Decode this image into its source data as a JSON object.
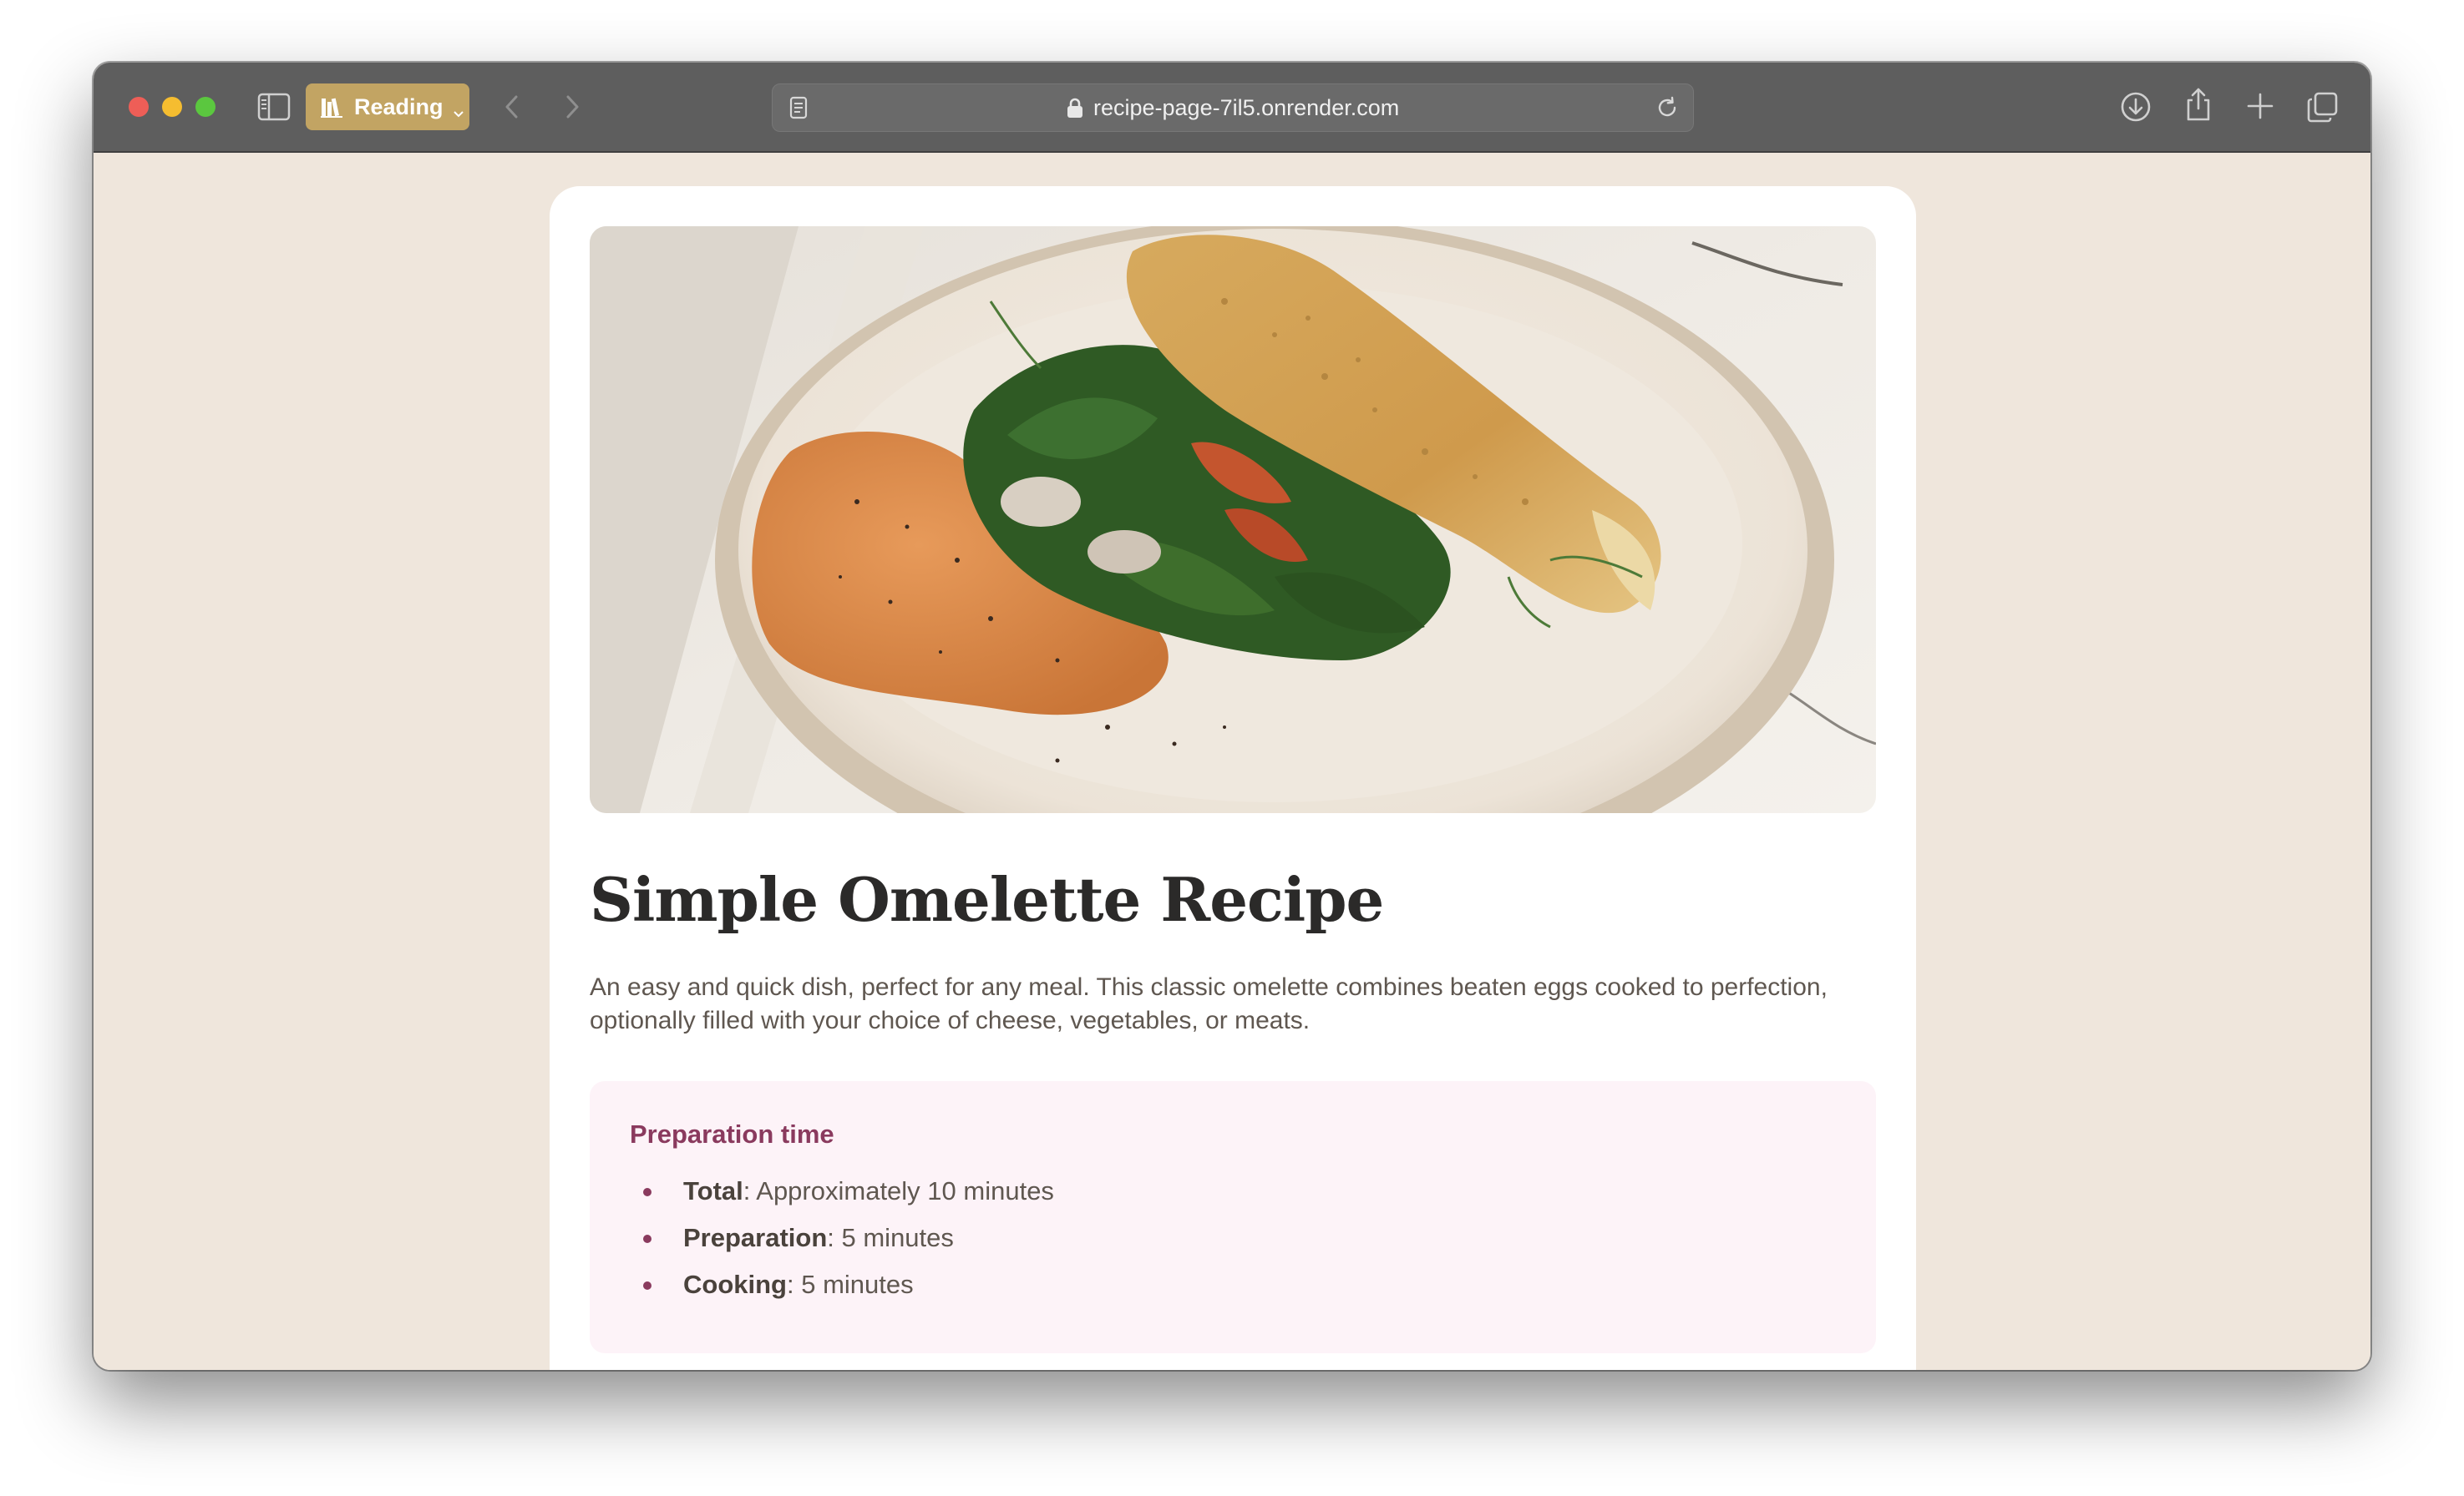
{
  "browser": {
    "reading_button_label": "Reading",
    "url": "recipe-page-7il5.onrender.com",
    "icons": [
      "sidebar-icon",
      "books-icon",
      "chevron-down-icon",
      "back-icon",
      "forward-icon",
      "page-icon",
      "lock-icon",
      "reload-icon",
      "download-icon",
      "share-icon",
      "plus-icon",
      "tabs-icon"
    ]
  },
  "recipe": {
    "image_alt": "omelette with spinach, dill and romesco on a plate",
    "title": "Simple Omelette Recipe",
    "description": "An easy and quick dish, perfect for any meal. This classic omelette combines beaten eggs cooked to perfection, optionally filled with your choice of cheese, vegetables, or meats.",
    "prep": {
      "title": "Preparation time",
      "items": [
        {
          "label": "Total",
          "value": ": Approximately 10 minutes"
        },
        {
          "label": "Preparation",
          "value": ": 5 minutes"
        },
        {
          "label": "Cooking",
          "value": ": 5 minutes"
        }
      ]
    }
  },
  "colors": {
    "page_bg": "#efe6dc",
    "card_bg": "#ffffff",
    "prep_bg": "#fdf3f8",
    "accent_rose": "#8a3a5e",
    "reading_button": "#c2a463"
  }
}
